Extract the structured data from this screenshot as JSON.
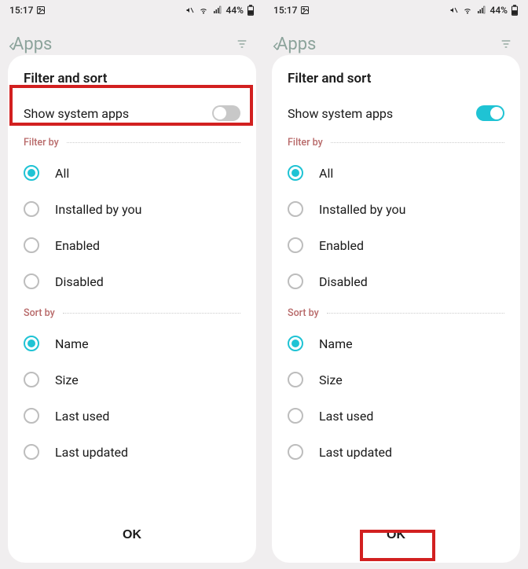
{
  "status": {
    "time": "15:17",
    "battery": "44%"
  },
  "header": {
    "apps_label": "Apps"
  },
  "modal": {
    "title": "Filter and sort",
    "toggle_label": "Show system apps",
    "filter_label": "Filter by",
    "sort_label": "Sort by",
    "ok_label": "OK",
    "filter_options": [
      {
        "label": "All",
        "selected": true
      },
      {
        "label": "Installed by you",
        "selected": false
      },
      {
        "label": "Enabled",
        "selected": false
      },
      {
        "label": "Disabled",
        "selected": false
      }
    ],
    "sort_options": [
      {
        "label": "Name",
        "selected": true
      },
      {
        "label": "Size",
        "selected": false
      },
      {
        "label": "Last used",
        "selected": false
      },
      {
        "label": "Last updated",
        "selected": false
      }
    ]
  },
  "left": {
    "toggle_on": false,
    "highlight": "toggle"
  },
  "right": {
    "toggle_on": true,
    "highlight": "ok"
  }
}
